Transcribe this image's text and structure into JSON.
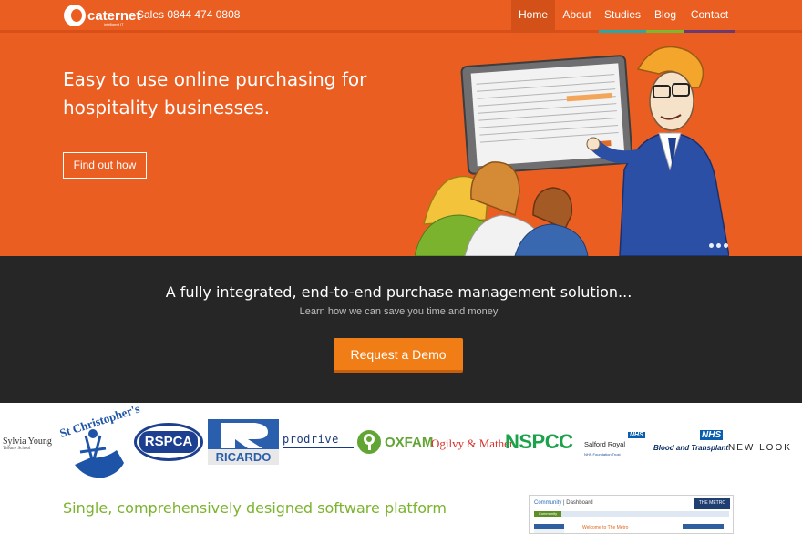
{
  "header": {
    "logo_text": "caternet",
    "logo_sub": "intelligent IT",
    "sales": "Sales 0844 474 0808",
    "nav": [
      {
        "label": "Home",
        "active": true
      },
      {
        "label": "About"
      },
      {
        "label": "Studies"
      },
      {
        "label": "Blog"
      },
      {
        "label": "Contact"
      }
    ],
    "nav_accent_colors": [
      "#2aa7a4",
      "#7cb82f",
      "#6a3a6e"
    ],
    "brand_color": "#eb5e22"
  },
  "hero": {
    "title": "Easy to use online purchasing for hospitality businesses.",
    "button": "Find out how",
    "illustration": "cartoon-presenter-with-screen"
  },
  "band": {
    "title": "A fully integrated, end-to-end purchase management solution...",
    "subtitle": "Learn how we can save you time and money",
    "button": "Request a Demo",
    "button_color": "#f07d16"
  },
  "logos": [
    {
      "name": "Sylvia Young",
      "sub": "Theatre School"
    },
    {
      "name": "St Christopher's"
    },
    {
      "name": "RSPCA"
    },
    {
      "name": "RICARDO"
    },
    {
      "name": "prodrive"
    },
    {
      "name": "OXFAM"
    },
    {
      "name": "Ogilvy & Mather"
    },
    {
      "name": "NSPCC"
    },
    {
      "name": "Salford Royal",
      "badge": "NHS",
      "sub": "NHS Foundation Trust"
    },
    {
      "name": "Blood and Transplant",
      "badge": "NHS"
    },
    {
      "name": "NEW LOOK"
    }
  ],
  "bottom": {
    "title": "Single, comprehensively designed software platform",
    "dashboard": {
      "crumb_1": "Community",
      "crumb_sep": " | ",
      "crumb_2": "Dashboard",
      "tab": "Community",
      "pill": "THE METRO",
      "welcome": "Welcome to The Metro"
    }
  }
}
